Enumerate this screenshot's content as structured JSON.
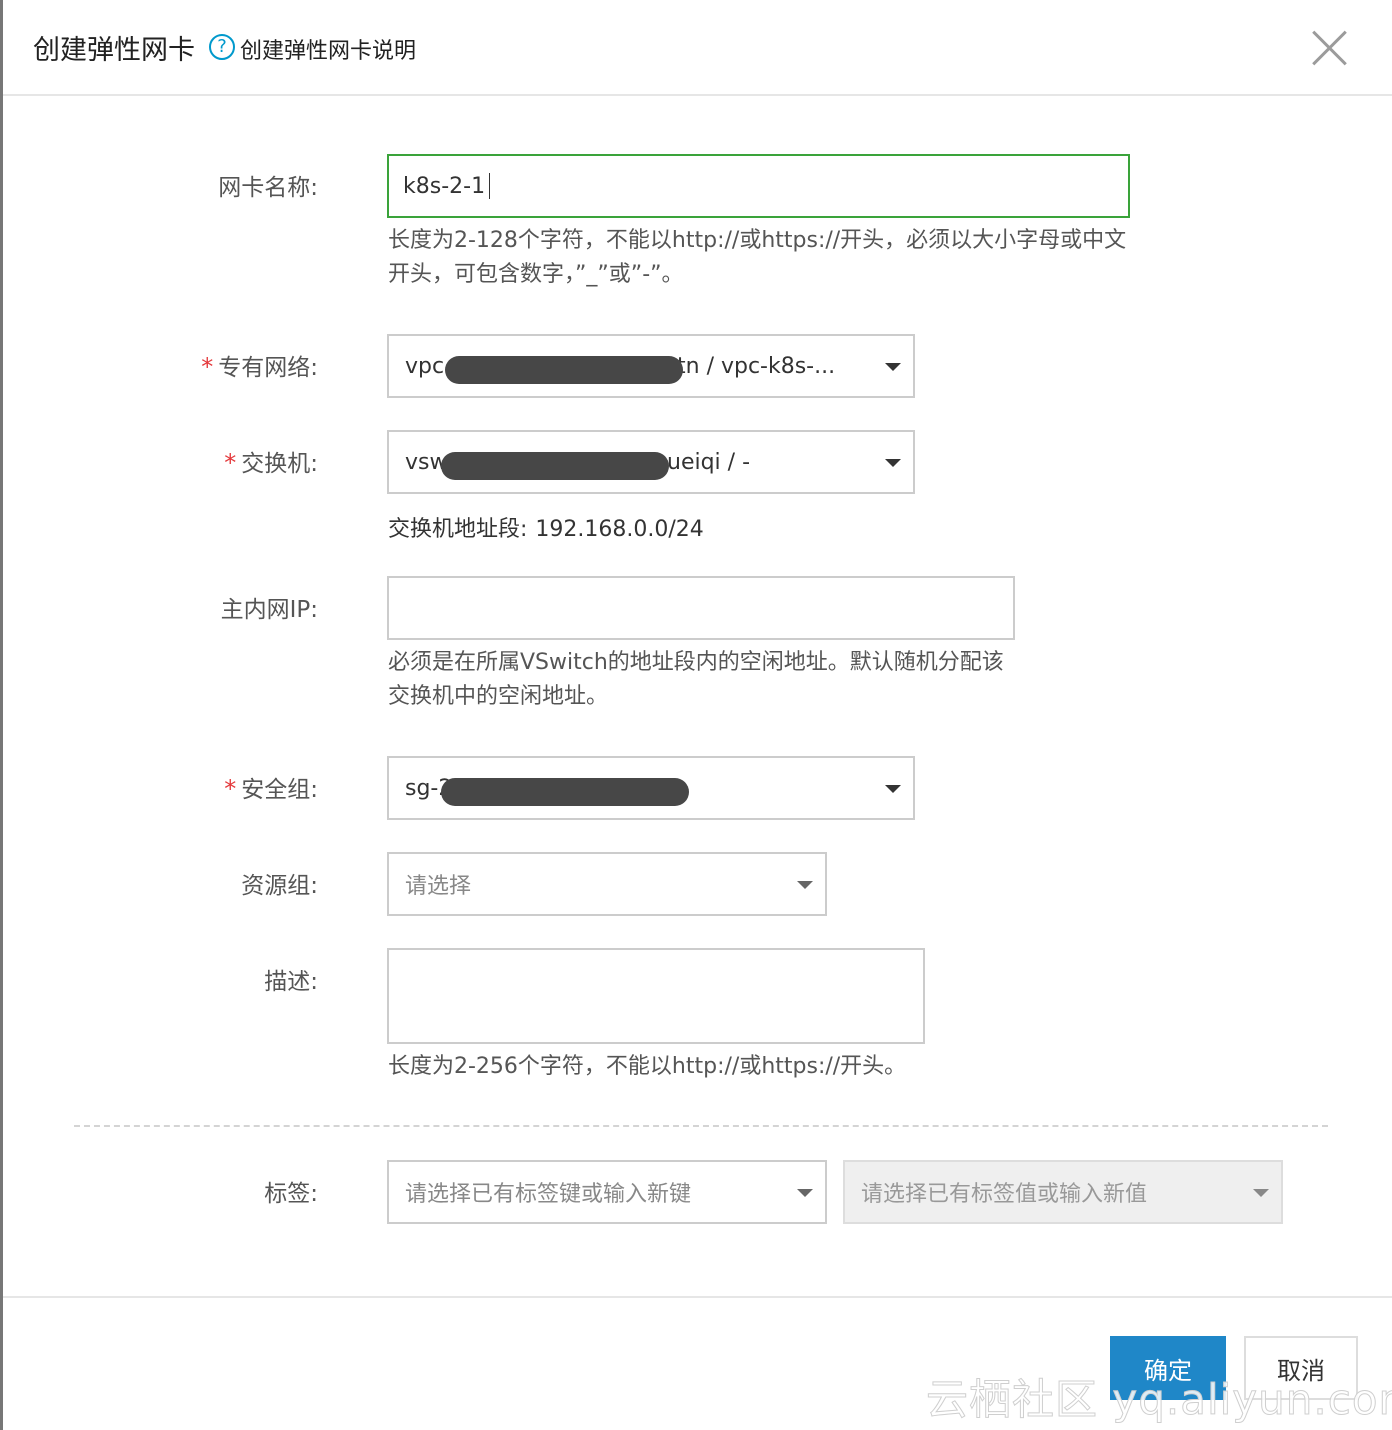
{
  "dialog": {
    "title": "创建弹性网卡",
    "help_icon": "question-circle-icon",
    "help_text": "创建弹性网卡说明",
    "close_icon": "close-icon"
  },
  "form": {
    "nic_name": {
      "label": "网卡名称:",
      "value": "k8s-2-1",
      "hint": "长度为2-128个字符，不能以http://或https://开头，必须以大小字母或中文开头，可包含数字，”_”或”-”。"
    },
    "vpc": {
      "label": "专有网络:",
      "required": "*",
      "value_prefix": "vpc",
      "value_suffix": "tn / vpc-k8s-..."
    },
    "vswitch": {
      "label": "交换机:",
      "required": "*",
      "value_prefix": "vsw",
      "value_suffix": "ueiqi / -",
      "cidr_label": "交换机地址段:",
      "cidr_value": "192.168.0.0/24"
    },
    "primary_ip": {
      "label": "主内网IP:",
      "value": "",
      "hint": "必须是在所属VSwitch的地址段内的空闲地址。默认随机分配该交换机中的空闲地址。"
    },
    "security_group": {
      "label": "安全组:",
      "required": "*",
      "value_prefix": "sg-2"
    },
    "resource_group": {
      "label": "资源组:",
      "placeholder": "请选择"
    },
    "description": {
      "label": "描述:",
      "value": "",
      "hint": "长度为2-256个字符，不能以http://或https://开头。"
    },
    "tags": {
      "label": "标签:",
      "key_placeholder": "请选择已有标签键或输入新键",
      "value_placeholder": "请选择已有标签值或输入新值"
    }
  },
  "footer": {
    "ok_label": "确定",
    "cancel_label": "取消"
  },
  "watermark": "云栖社区 yq.aliyun.com",
  "colors": {
    "primary": "#1f87c8",
    "required": "#e4393c",
    "focus_border": "#3aa33a",
    "help": "#0099cc"
  }
}
